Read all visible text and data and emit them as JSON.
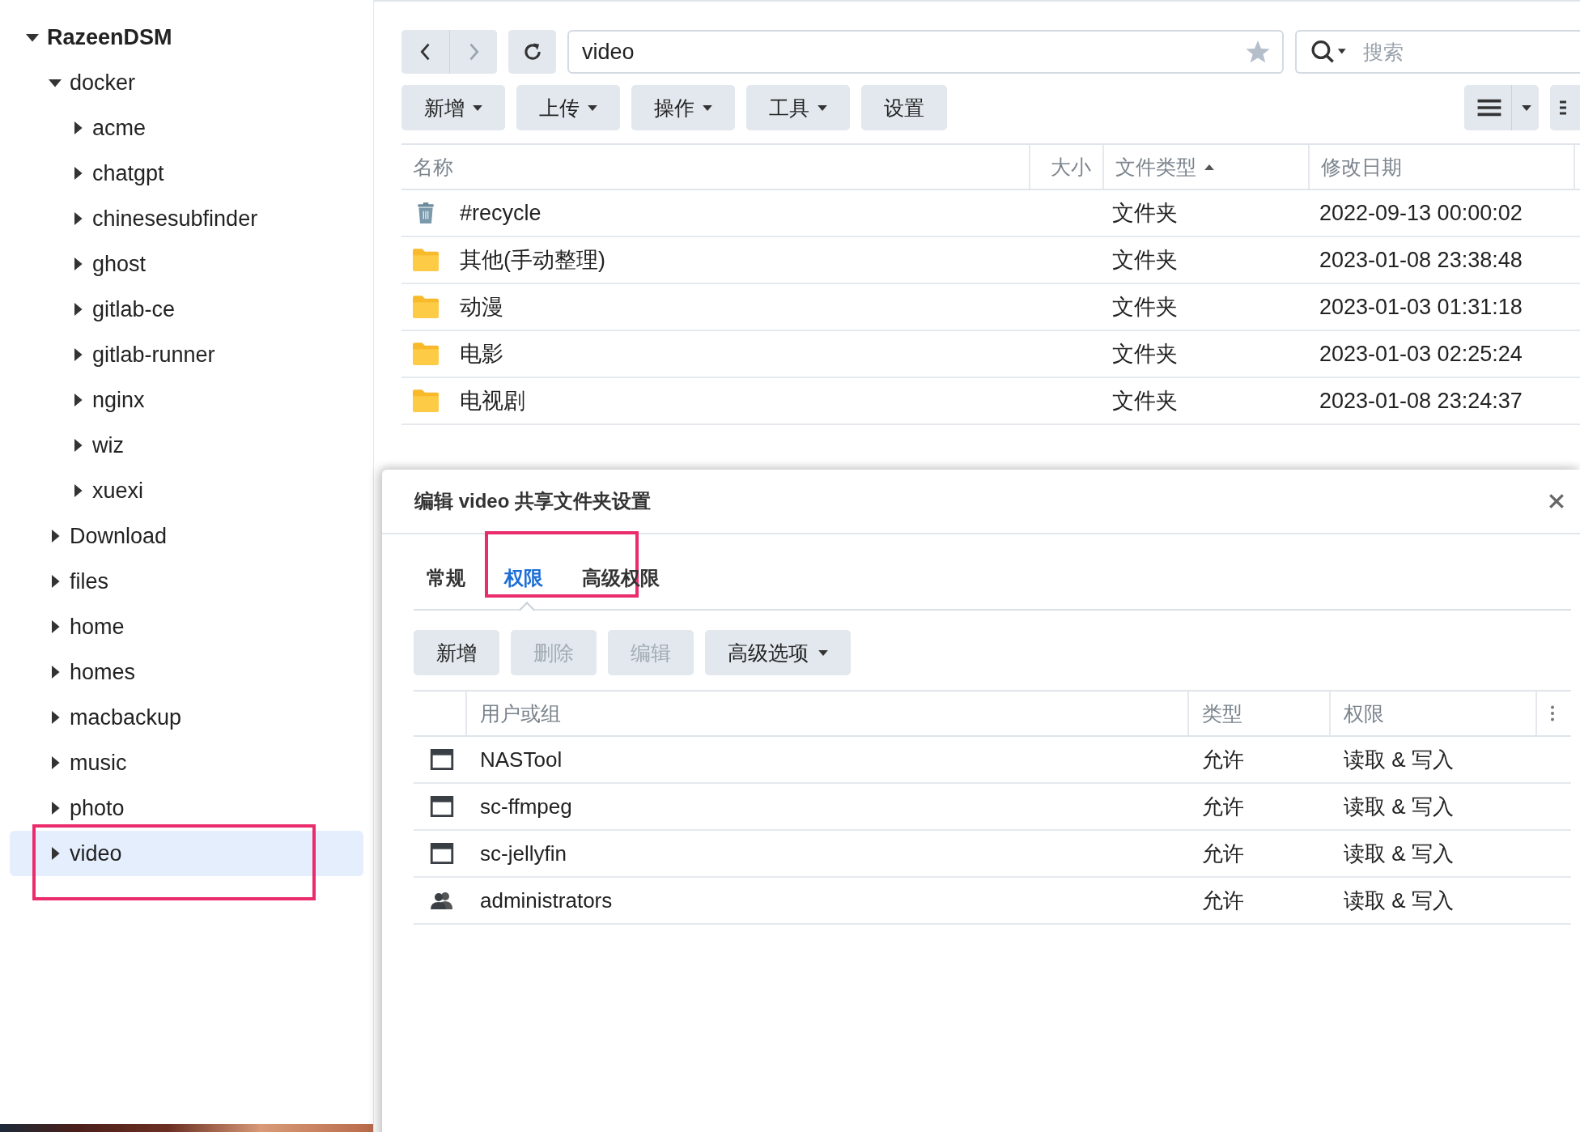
{
  "sidebar": {
    "tree": [
      {
        "label": "RazeenDSM",
        "expanded": true,
        "selected": false,
        "highlighted": false,
        "children": [
          {
            "label": "docker",
            "expanded": true,
            "selected": false,
            "highlighted": false,
            "children": [
              {
                "label": "acme",
                "expanded": false,
                "selected": false,
                "highlighted": false
              },
              {
                "label": "chatgpt",
                "expanded": false,
                "selected": false,
                "highlighted": false
              },
              {
                "label": "chinesesubfinder",
                "expanded": false,
                "selected": false,
                "highlighted": false
              },
              {
                "label": "ghost",
                "expanded": false,
                "selected": false,
                "highlighted": false
              },
              {
                "label": "gitlab-ce",
                "expanded": false,
                "selected": false,
                "highlighted": false
              },
              {
                "label": "gitlab-runner",
                "expanded": false,
                "selected": false,
                "highlighted": false
              },
              {
                "label": "nginx",
                "expanded": false,
                "selected": false,
                "highlighted": false
              },
              {
                "label": "wiz",
                "expanded": false,
                "selected": false,
                "highlighted": false
              },
              {
                "label": "xuexi",
                "expanded": false,
                "selected": false,
                "highlighted": false
              }
            ]
          },
          {
            "label": "Download",
            "expanded": false,
            "selected": false,
            "highlighted": false
          },
          {
            "label": "files",
            "expanded": false,
            "selected": false,
            "highlighted": false
          },
          {
            "label": "home",
            "expanded": false,
            "selected": false,
            "highlighted": false
          },
          {
            "label": "homes",
            "expanded": false,
            "selected": false,
            "highlighted": false
          },
          {
            "label": "macbackup",
            "expanded": false,
            "selected": false,
            "highlighted": false
          },
          {
            "label": "music",
            "expanded": false,
            "selected": false,
            "highlighted": false
          },
          {
            "label": "photo",
            "expanded": false,
            "selected": false,
            "highlighted": false
          },
          {
            "label": "video",
            "expanded": false,
            "selected": true,
            "highlighted": true
          }
        ]
      }
    ]
  },
  "toolbar": {
    "back_disabled": false,
    "forward_disabled": true,
    "path": "video",
    "search": {
      "placeholder": "搜索"
    },
    "buttons": [
      {
        "label": "新增",
        "dropdown": true
      },
      {
        "label": "上传",
        "dropdown": true
      },
      {
        "label": "操作",
        "dropdown": true
      },
      {
        "label": "工具",
        "dropdown": true
      },
      {
        "label": "设置",
        "dropdown": false
      }
    ]
  },
  "file_table": {
    "columns": [
      {
        "label": "名称",
        "sorted_ascending": false
      },
      {
        "label": "大小",
        "sorted_ascending": false
      },
      {
        "label": "文件类型",
        "sorted_ascending": true
      },
      {
        "label": "修改日期",
        "sorted_ascending": false
      }
    ],
    "rows": [
      {
        "kind": "recycle",
        "name": "#recycle",
        "type": "文件夹",
        "modified": "2022-09-13 00:00:02"
      },
      {
        "kind": "folder",
        "name": "其他(手动整理)",
        "type": "文件夹",
        "modified": "2023-01-08 23:38:48"
      },
      {
        "kind": "folder",
        "name": "动漫",
        "type": "文件夹",
        "modified": "2023-01-03 01:31:18"
      },
      {
        "kind": "folder",
        "name": "电影",
        "type": "文件夹",
        "modified": "2023-01-03 02:25:24"
      },
      {
        "kind": "folder",
        "name": "电视剧",
        "type": "文件夹",
        "modified": "2023-01-08 23:24:37"
      }
    ]
  },
  "dialog": {
    "title": "编辑 video 共享文件夹设置",
    "tabs": [
      {
        "label": "常规",
        "selected": false,
        "highlighted": false
      },
      {
        "label": "权限",
        "selected": true,
        "highlighted": true
      },
      {
        "label": "高级权限",
        "selected": false,
        "highlighted": false
      }
    ],
    "buttons": [
      {
        "label": "新增",
        "disabled": false,
        "dropdown": false
      },
      {
        "label": "删除",
        "disabled": true,
        "dropdown": false
      },
      {
        "label": "编辑",
        "disabled": true,
        "dropdown": false
      },
      {
        "label": "高级选项",
        "disabled": false,
        "dropdown": true
      }
    ],
    "columns": [
      "用户或组",
      "类型",
      "权限"
    ],
    "rows": [
      {
        "kind": "user",
        "name": "NASTool",
        "type": "允许",
        "permission": "读取 & 写入"
      },
      {
        "kind": "user",
        "name": "sc-ffmpeg",
        "type": "允许",
        "permission": "读取 & 写入"
      },
      {
        "kind": "user",
        "name": "sc-jellyfin",
        "type": "允许",
        "permission": "读取 & 写入"
      },
      {
        "kind": "group",
        "name": "administrators",
        "type": "允许",
        "permission": "读取 & 写入"
      }
    ]
  }
}
